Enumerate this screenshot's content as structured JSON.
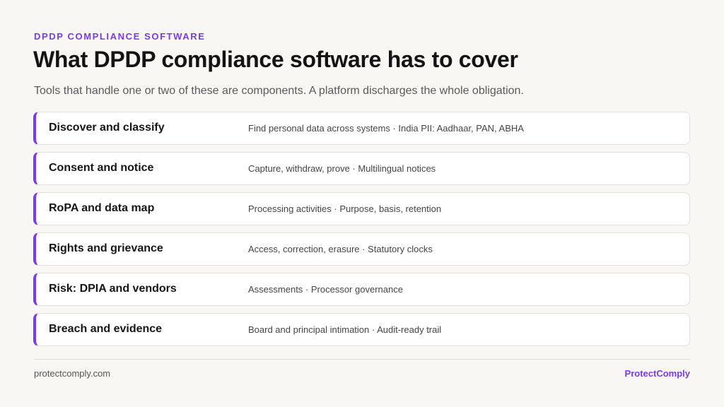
{
  "header": {
    "eyebrow": "DPDP COMPLIANCE SOFTWARE",
    "title": "What DPDP compliance software has to cover",
    "subtitle": "Tools that handle one or two of these are components. A platform discharges the whole obligation."
  },
  "rows": [
    {
      "label": "Discover and classify",
      "description": "Find personal data across systems · India PII: Aadhaar, PAN, ABHA"
    },
    {
      "label": "Consent and notice",
      "description": "Capture, withdraw, prove · Multilingual notices"
    },
    {
      "label": "RoPA and data map",
      "description": "Processing activities · Purpose, basis, retention"
    },
    {
      "label": "Rights and grievance",
      "description": "Access, correction, erasure · Statutory clocks"
    },
    {
      "label": "Risk: DPIA and vendors",
      "description": "Assessments · Processor governance"
    },
    {
      "label": "Breach and evidence",
      "description": "Board and principal intimation · Audit-ready trail"
    }
  ],
  "footer": {
    "site": "protectcomply.com",
    "brand": "ProtectComply"
  },
  "colors": {
    "accent": "#7c3aed",
    "background": "#f8f7f4"
  }
}
